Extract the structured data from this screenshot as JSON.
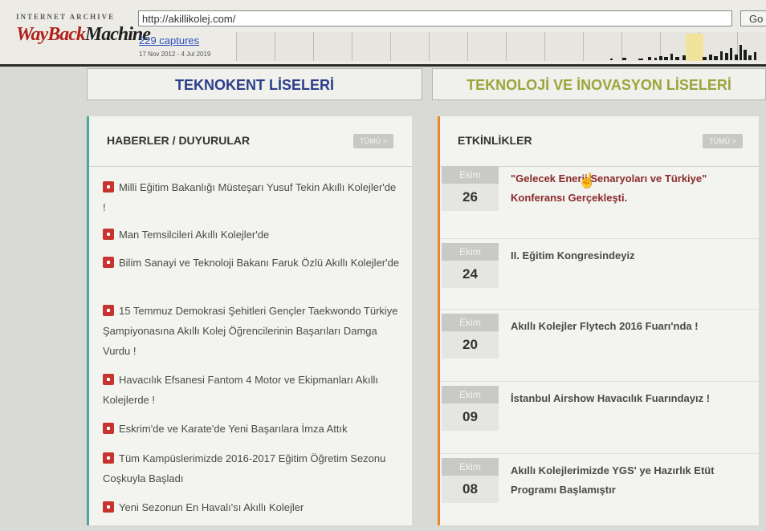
{
  "wayback": {
    "logo_top": "INTERNET ARCHIVE",
    "logo_part1": "WayBack",
    "logo_part2": "Machine",
    "url": "http://akillikolej.com/",
    "go_label": "Go",
    "captures": "229 captures",
    "range": "17 Nov 2012 - 4 Jul 2019"
  },
  "tabs": [
    {
      "label": "TEKNOKENT LİSELERİ"
    },
    {
      "label": "TEKNOLOJİ VE İNOVASYON LİSELERİ"
    }
  ],
  "news": {
    "title": "HABERLER / DUYURULAR",
    "more": "TÜMÜ >",
    "items": [
      {
        "text": "Milli Eğitim Bakanlığı Müsteşarı Yusuf Tekin Akıllı Kolejler'de !"
      },
      {
        "text": "Man Temsilcileri Akıllı Kolejler'de"
      },
      {
        "text": "Bilim Sanayi ve Teknoloji Bakanı Faruk Özlü Akıllı Kolejler'de"
      },
      {
        "text": "15 Temmuz Demokrasi Şehitleri Gençler Taekwondo Türkiye Şampiyonasına Akıllı Kolej Öğrencilerinin Başarıları Damga Vurdu !"
      },
      {
        "text": "Havacılık Efsanesi Fantom 4 Motor ve Ekipmanları Akıllı Kolejlerde !"
      },
      {
        "text": "Eskrim'de ve Karate'de Yeni Başarılara İmza Attık"
      },
      {
        "text": "Tüm Kampüslerimizde 2016-2017 Eğitim Öğretim Sezonu Coşkuyla Başladı"
      },
      {
        "text": "Yeni Sezonun En Havalı'sı Akıllı Kolejler"
      }
    ]
  },
  "events": {
    "title": "ETKİNLİKLER",
    "more": "TÜMÜ >",
    "items": [
      {
        "month": "Ekim",
        "day": "26",
        "title": "\"Gelecek Enerji Senaryoları ve Türkiye\" Konferansı Gerçekleşti."
      },
      {
        "month": "Ekim",
        "day": "24",
        "title": "II. Eğitim Kongresindeyiz"
      },
      {
        "month": "Ekim",
        "day": "20",
        "title": "Akıllı Kolejler Flytech 2016 Fuarı'nda !"
      },
      {
        "month": "Ekim",
        "day": "09",
        "title": "İstanbul Airshow Havacılık Fuarındayız !"
      },
      {
        "month": "Ekim",
        "day": "08",
        "title": "Akıllı Kolejlerimizde YGS' ye Hazırlık Etüt Programı Başlamıştır"
      }
    ]
  },
  "colors": {
    "accent_news": "#4aa89a",
    "accent_events": "#e68a2e",
    "bullet": "#c7332e",
    "tab_a": "#2c3e8a",
    "tab_b": "#9aa63a"
  }
}
